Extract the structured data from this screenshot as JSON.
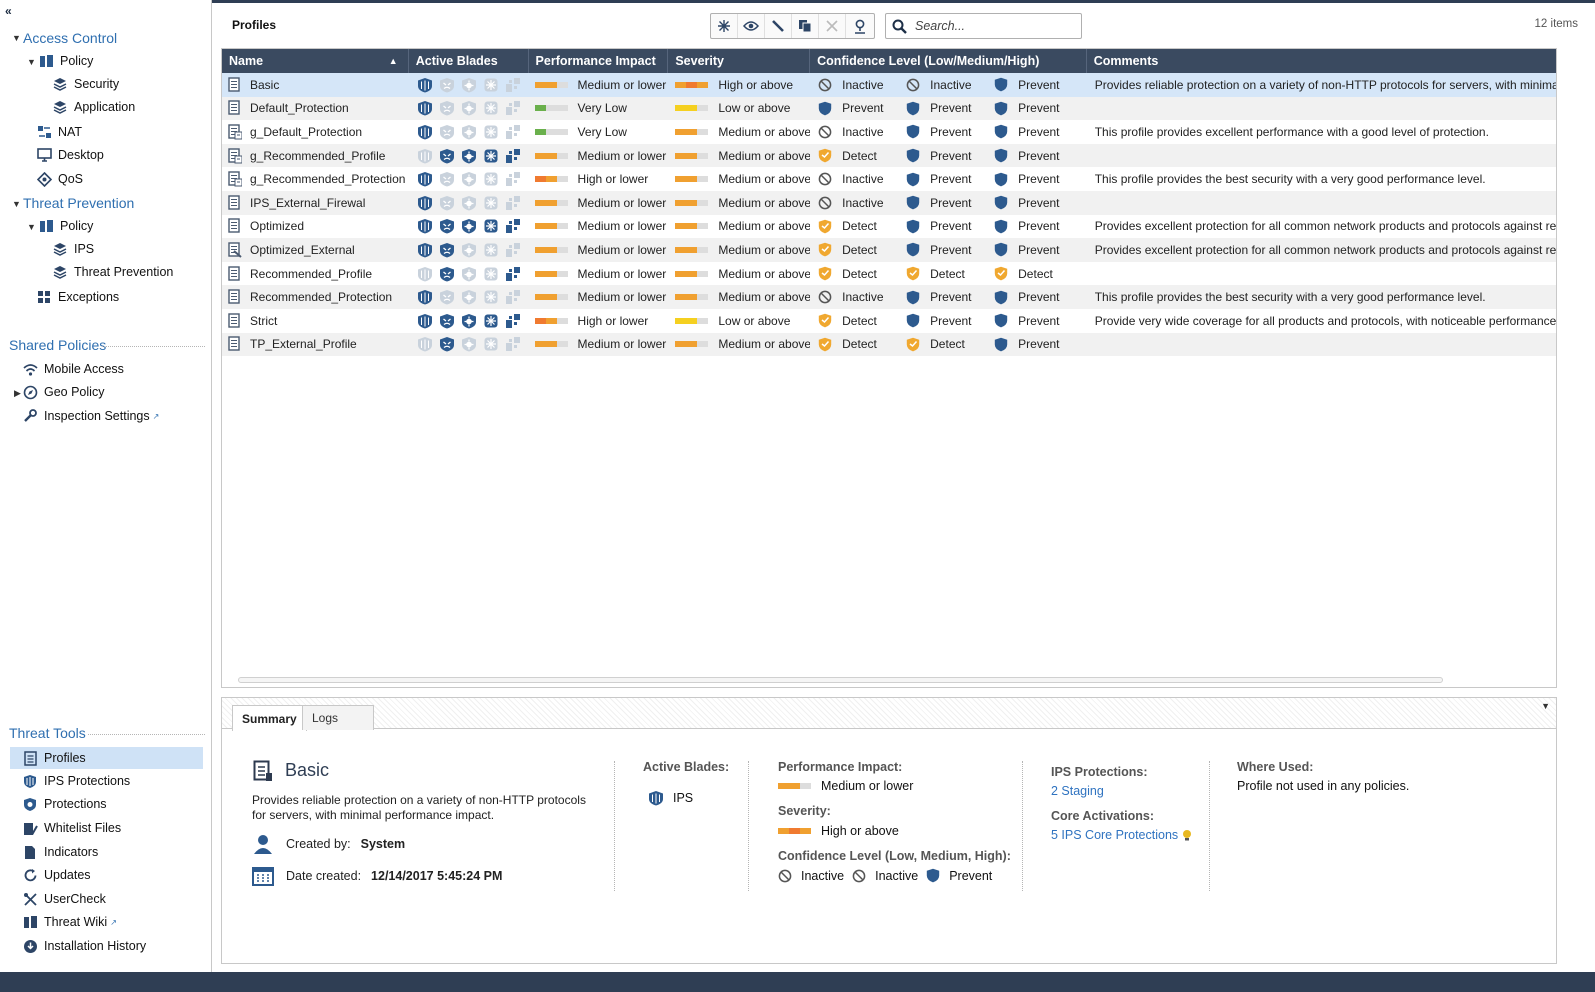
{
  "sidebar": {
    "access_control": {
      "label": "Access Control",
      "policy": "Policy",
      "security": "Security",
      "application": "Application",
      "nat": "NAT",
      "desktop": "Desktop",
      "qos": "QoS"
    },
    "threat_prevention": {
      "label": "Threat Prevention",
      "policy": "Policy",
      "ips": "IPS",
      "threat_prevention": "Threat Prevention",
      "exceptions": "Exceptions"
    },
    "shared_policies": {
      "label": "Shared Policies",
      "mobile_access": "Mobile Access",
      "geo_policy": "Geo Policy",
      "inspection_settings": "Inspection Settings"
    },
    "threat_tools": {
      "label": "Threat Tools",
      "profiles": "Profiles",
      "ips_protections": "IPS Protections",
      "protections": "Protections",
      "whitelist_files": "Whitelist Files",
      "indicators": "Indicators",
      "updates": "Updates",
      "usercheck": "UserCheck",
      "threat_wiki": "Threat Wiki",
      "installation_history": "Installation History"
    }
  },
  "header": {
    "title": "Profiles",
    "search_placeholder": "Search...",
    "items_count": "12 items"
  },
  "columns": {
    "name": "Name",
    "blades": "Active Blades",
    "perf": "Performance Impact",
    "sev": "Severity",
    "conf": "Confidence Level (Low/Medium/High)",
    "comments": "Comments"
  },
  "rows": [
    {
      "name": "Basic",
      "blades": [
        1,
        0,
        0,
        0,
        0
      ],
      "perf": "Medium or lower",
      "perf_level": "medium",
      "sev": "High or above",
      "sev_level": "high",
      "conf": [
        "Inactive",
        "Inactive",
        "Prevent"
      ],
      "comment": "Provides reliable protection on a variety of non-HTTP protocols for servers, with minimal performance impact."
    },
    {
      "name": "Default_Protection",
      "blades": [
        1,
        0,
        0,
        0,
        0
      ],
      "perf": "Very Low",
      "perf_level": "verylow",
      "sev": "Low or above",
      "sev_level": "low",
      "conf": [
        "Prevent",
        "Prevent",
        "Prevent"
      ],
      "comment": ""
    },
    {
      "name": "g_Default_Protection",
      "blades": [
        1,
        0,
        0,
        0,
        0
      ],
      "perf": "Very Low",
      "perf_level": "verylow",
      "sev": "Medium or above",
      "sev_level": "medium",
      "conf": [
        "Inactive",
        "Prevent",
        "Prevent"
      ],
      "comment": "This profile provides excellent performance with a good level of protection."
    },
    {
      "name": "g_Recommended_Profile",
      "blades": [
        0,
        1,
        1,
        1,
        1
      ],
      "perf": "Medium or lower",
      "perf_level": "medium",
      "sev": "Medium or above",
      "sev_level": "medium",
      "conf": [
        "Detect",
        "Prevent",
        "Prevent"
      ],
      "comment": ""
    },
    {
      "name": "g_Recommended_Protection",
      "blades": [
        1,
        0,
        0,
        0,
        0
      ],
      "perf": "High or lower",
      "perf_level": "high",
      "sev": "Medium or above",
      "sev_level": "medium",
      "conf": [
        "Inactive",
        "Prevent",
        "Prevent"
      ],
      "comment": "This profile provides the best security with a very good performance level."
    },
    {
      "name": "IPS_External_Firewal",
      "blades": [
        1,
        0,
        0,
        0,
        0
      ],
      "perf": "Medium or lower",
      "perf_level": "medium",
      "sev": "Medium or above",
      "sev_level": "medium",
      "conf": [
        "Inactive",
        "Prevent",
        "Prevent"
      ],
      "comment": ""
    },
    {
      "name": "Optimized",
      "blades": [
        1,
        1,
        1,
        1,
        1
      ],
      "perf": "Medium or lower",
      "perf_level": "medium",
      "sev": "Medium or above",
      "sev_level": "medium",
      "conf": [
        "Detect",
        "Prevent",
        "Prevent"
      ],
      "comment": "Provides excellent protection for all common network products and protocols against recent and popular industry threats."
    },
    {
      "name": "Optimized_External",
      "blades": [
        1,
        1,
        0,
        0,
        0
      ],
      "perf": "Medium or lower",
      "perf_level": "medium",
      "sev": "Medium or above",
      "sev_level": "medium",
      "conf": [
        "Detect",
        "Prevent",
        "Prevent"
      ],
      "comment": "Provides excellent protection for all common network products and protocols against recent and popular industry threats."
    },
    {
      "name": "Recommended_Profile",
      "blades": [
        0,
        1,
        0,
        0,
        1
      ],
      "perf": "Medium or lower",
      "perf_level": "medium",
      "sev": "Medium or above",
      "sev_level": "medium",
      "conf": [
        "Detect",
        "Detect",
        "Detect"
      ],
      "comment": ""
    },
    {
      "name": "Recommended_Protection",
      "blades": [
        1,
        0,
        0,
        0,
        0
      ],
      "perf": "Medium or lower",
      "perf_level": "medium",
      "sev": "Medium or above",
      "sev_level": "medium",
      "conf": [
        "Inactive",
        "Prevent",
        "Prevent"
      ],
      "comment": "This profile provides the best security with a very good performance level."
    },
    {
      "name": "Strict",
      "blades": [
        1,
        1,
        1,
        1,
        1
      ],
      "perf": "High or lower",
      "perf_level": "high",
      "sev": "Low or above",
      "sev_level": "low",
      "conf": [
        "Detect",
        "Prevent",
        "Prevent"
      ],
      "comment": "Provide very wide coverage for all products and protocols, with noticeable performance impact."
    },
    {
      "name": "TP_External_Profile",
      "blades": [
        0,
        1,
        0,
        0,
        0
      ],
      "perf": "Medium or lower",
      "perf_level": "medium",
      "sev": "Medium or above",
      "sev_level": "medium",
      "conf": [
        "Detect",
        "Detect",
        "Prevent"
      ],
      "comment": ""
    }
  ],
  "summary": {
    "tab_summary": "Summary",
    "tab_logs": "Logs",
    "title": "Basic",
    "description": "Provides reliable protection on a variety of non-HTTP protocols for servers, with minimal performance impact.",
    "created_by_label": "Created by:",
    "created_by": "System",
    "date_created_label": "Date created:",
    "date_created": "12/14/2017 5:45:24 PM",
    "active_blades_label": "Active Blades:",
    "active_blade": "IPS",
    "perf_label": "Performance Impact:",
    "perf": "Medium or lower",
    "sev_label": "Severity:",
    "sev": "High or above",
    "conf_label": "Confidence Level (Low, Medium, High):",
    "conf": [
      "Inactive",
      "Inactive",
      "Prevent"
    ],
    "ips_label": "IPS Protections:",
    "ips_value": "2 Staging",
    "core_label": "Core Activations:",
    "core_value": "5 IPS Core Protections",
    "where_label": "Where Used:",
    "where_value": "Profile not used in any policies."
  },
  "colors": {
    "header_bg": "#3a4a60",
    "link": "#2f73c0",
    "shield": "#2d5a8e",
    "detect": "#f0a830",
    "bar_orange": "#f0a030",
    "bar_green": "#6ab04c",
    "bar_yellow": "#f5d020"
  }
}
